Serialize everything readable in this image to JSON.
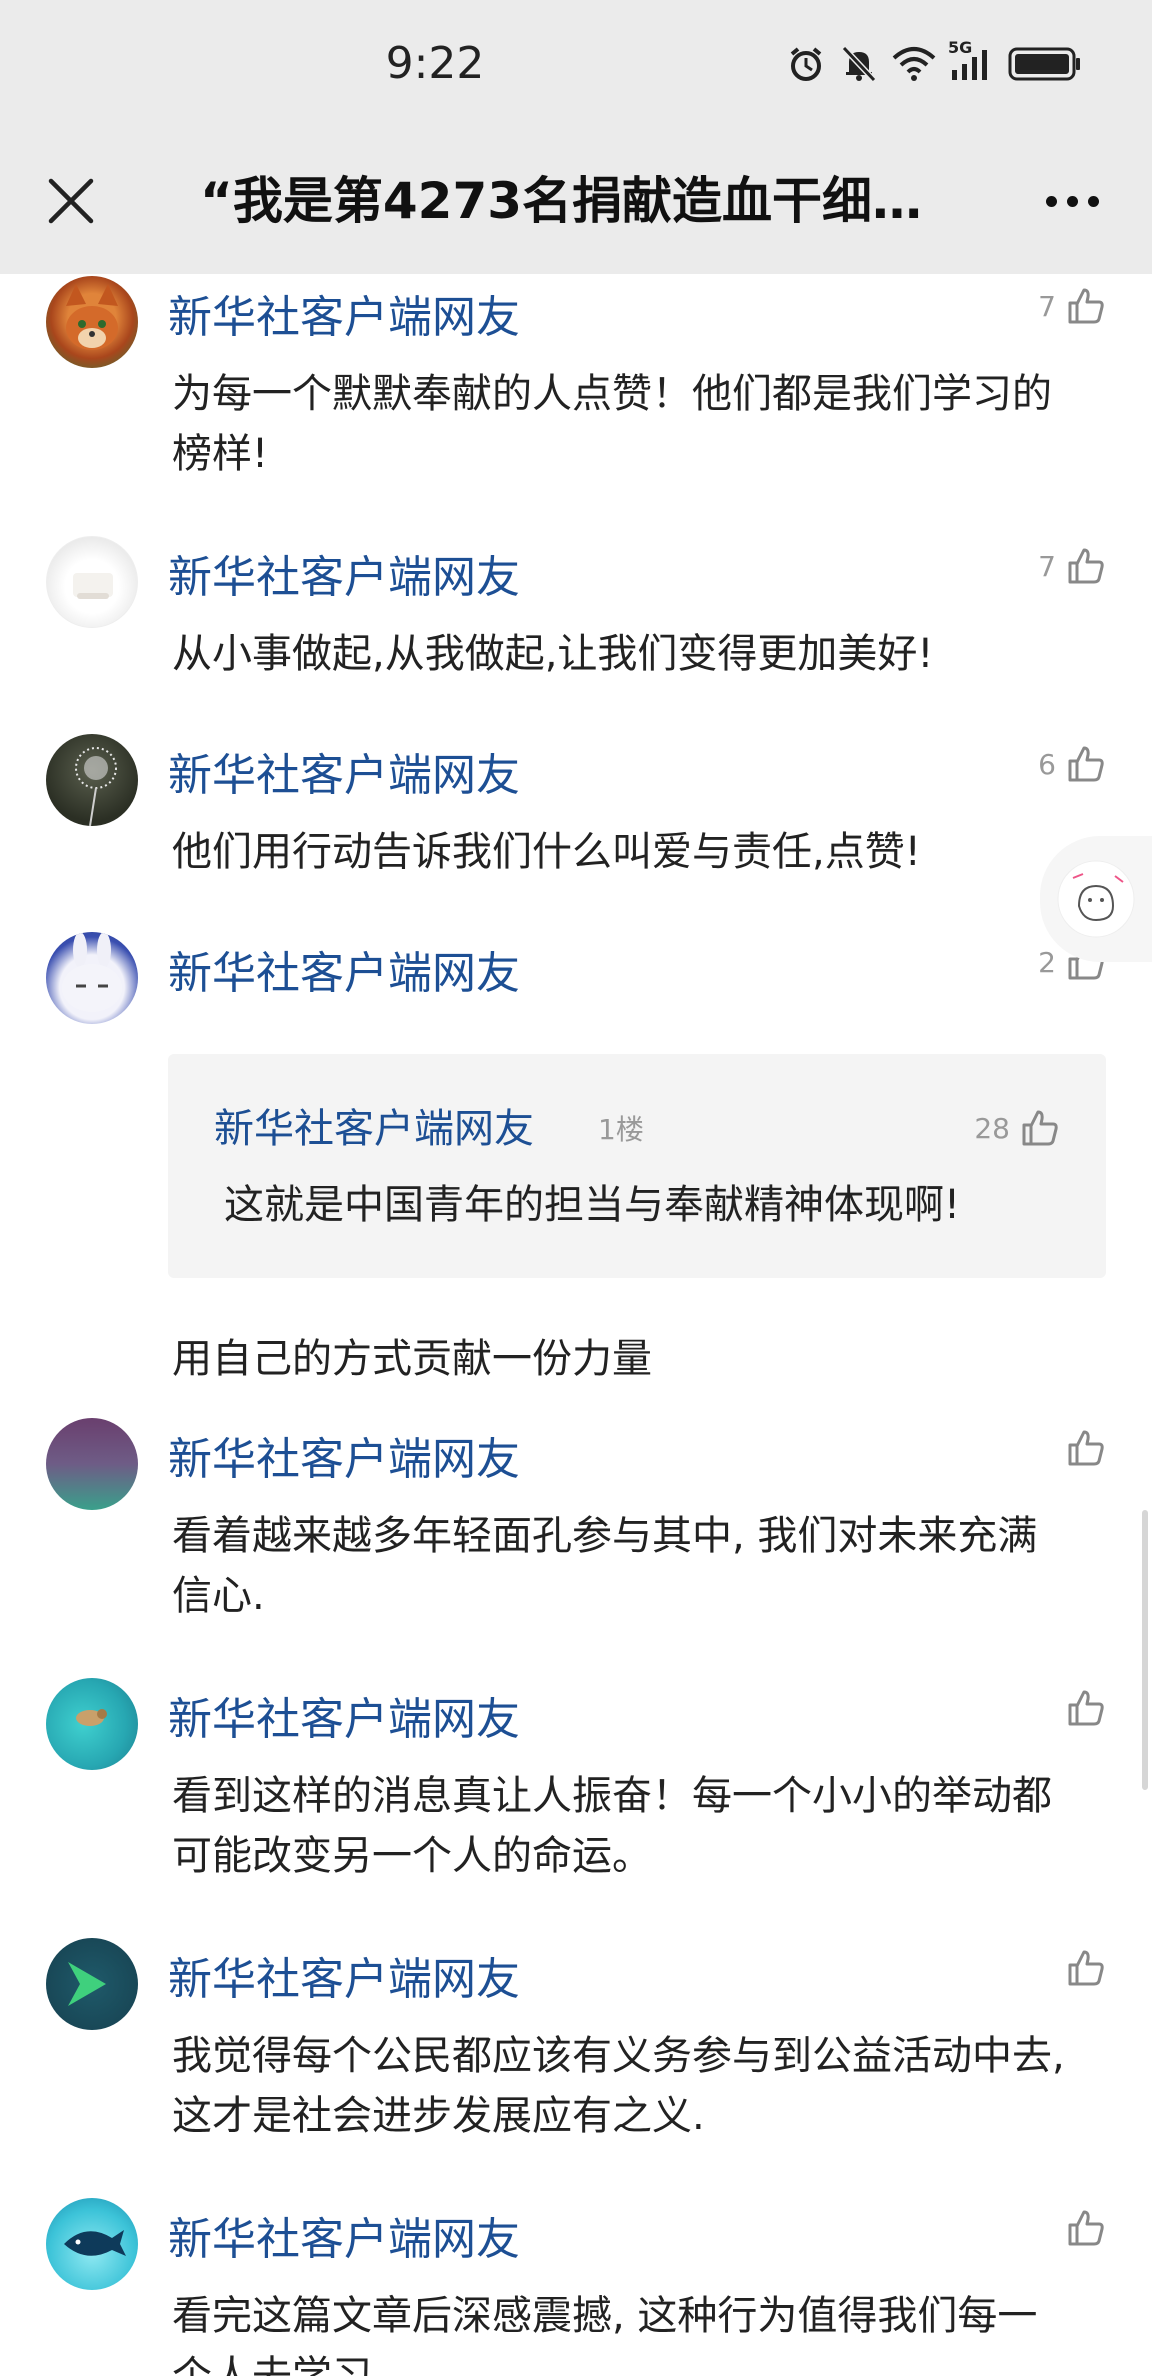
{
  "status_bar": {
    "time": "9:22",
    "signal_label": "5G"
  },
  "nav": {
    "title": "“我是第4273名捐献造血干细…"
  },
  "colors": {
    "username": "#1d4f94",
    "background": "#ffffff",
    "topbar": "#ebebeb"
  },
  "comments": [
    {
      "username": "新华社客户端网友",
      "likes": "7",
      "text": "为每一个默默奉献的人点赞！他们都是我们学习的榜样!"
    },
    {
      "username": "新华社客户端网友",
      "likes": "7",
      "text": "从小事做起,从我做起,让我们变得更加美好!"
    },
    {
      "username": "新华社客户端网友",
      "likes": "6",
      "text": "他们用行动告诉我们什么叫爱与责任,点赞!"
    },
    {
      "username": "新华社客户端网友",
      "likes": "2",
      "text": "用自己的方式贡献一份力量",
      "reply": {
        "username": "新华社客户端网友",
        "floor": "1楼",
        "likes": "28",
        "text": "这就是中国青年的担当与奉献精神体现啊!"
      }
    },
    {
      "username": "新华社客户端网友",
      "likes": "",
      "text": "看着越来越多年轻面孔参与其中, 我们对未来充满信心."
    },
    {
      "username": "新华社客户端网友",
      "likes": "",
      "text": "看到这样的消息真让人振奋！每一个小小的举动都可能改变另一个人的命运。"
    },
    {
      "username": "新华社客户端网友",
      "likes": "",
      "text": "我觉得每个公民都应该有义务参与到公益活动中去, 这才是社会进步发展应有之义."
    },
    {
      "username": "新华社客户端网友",
      "likes": "",
      "text": "看完这篇文章后深感震撼, 这种行为值得我们每一个人去学习"
    }
  ]
}
